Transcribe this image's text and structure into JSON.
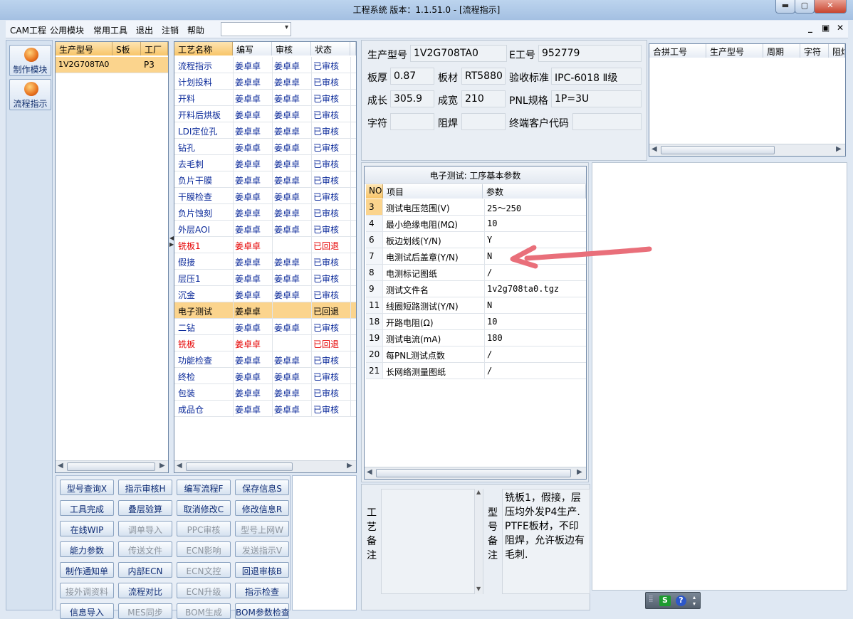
{
  "window": {
    "title": "工程系统  版本：1.1.51.0 - [流程指示]",
    "minimize": "▬",
    "maximize": "▢",
    "close": "✕"
  },
  "menu": {
    "items": [
      "CAM工程",
      "公用模块",
      "常用工具",
      "退出",
      "注销",
      "帮助"
    ],
    "combo_value": "",
    "mdi": [
      "_",
      "▣",
      "✕"
    ]
  },
  "nav": [
    {
      "label": "制作模块",
      "icon": "app-orb-icon"
    },
    {
      "label": "流程指示",
      "icon": "flow-orb-icon"
    }
  ],
  "model_list": {
    "headers": [
      "生产型号",
      "S板",
      "工厂"
    ],
    "rows": [
      [
        "1V2G708TA0",
        "",
        "P3"
      ]
    ]
  },
  "process": {
    "headers": [
      "工艺名称",
      "编写",
      "审核",
      "状态"
    ],
    "rows": [
      [
        "流程指示",
        "姜卓卓",
        "姜卓卓",
        "已审核"
      ],
      [
        "计划投料",
        "姜卓卓",
        "姜卓卓",
        "已审核"
      ],
      [
        "开料",
        "姜卓卓",
        "姜卓卓",
        "已审核"
      ],
      [
        "开料后烘板",
        "姜卓卓",
        "姜卓卓",
        "已审核"
      ],
      [
        "LDI定位孔",
        "姜卓卓",
        "姜卓卓",
        "已审核"
      ],
      [
        "钻孔",
        "姜卓卓",
        "姜卓卓",
        "已审核"
      ],
      [
        "去毛刺",
        "姜卓卓",
        "姜卓卓",
        "已审核"
      ],
      [
        "负片干膜",
        "姜卓卓",
        "姜卓卓",
        "已审核"
      ],
      [
        "干膜检查",
        "姜卓卓",
        "姜卓卓",
        "已审核"
      ],
      [
        "负片蚀刻",
        "姜卓卓",
        "姜卓卓",
        "已审核"
      ],
      [
        "外层AOI",
        "姜卓卓",
        "姜卓卓",
        "已审核"
      ],
      [
        "铣板1",
        "姜卓卓",
        "",
        "已回退"
      ],
      [
        "假接",
        "姜卓卓",
        "姜卓卓",
        "已审核"
      ],
      [
        "层压1",
        "姜卓卓",
        "姜卓卓",
        "已审核"
      ],
      [
        "沉金",
        "姜卓卓",
        "姜卓卓",
        "已审核"
      ],
      [
        "电子测试",
        "姜卓卓",
        "",
        "已回退"
      ],
      [
        "二钻",
        "姜卓卓",
        "姜卓卓",
        "已审核"
      ],
      [
        "铣板",
        "姜卓卓",
        "",
        "已回退"
      ],
      [
        "功能检查",
        "姜卓卓",
        "姜卓卓",
        "已审核"
      ],
      [
        "终检",
        "姜卓卓",
        "姜卓卓",
        "已审核"
      ],
      [
        "包装",
        "姜卓卓",
        "姜卓卓",
        "已审核"
      ],
      [
        "成品仓",
        "姜卓卓",
        "姜卓卓",
        "已审核"
      ]
    ],
    "status_colors": {
      "已审核": "#0b2a9a",
      "已回退": "#e60000"
    }
  },
  "buttons": [
    [
      "型号查询X",
      "指示审核H",
      "编写流程F",
      "保存信息S"
    ],
    [
      "工具完成",
      "叠层验算",
      "取消修改C",
      "修改信息R"
    ],
    [
      "在线WIP",
      "调单导入",
      "PPC审核",
      "型号上网W"
    ],
    [
      "能力参数",
      "传送文件",
      "ECN影响",
      "发送指示V"
    ],
    [
      "制作通知单",
      "内部ECN",
      "ECN文控",
      "回退审核B"
    ],
    [
      "接外调资料",
      "流程对比",
      "ECN升级",
      "指示检查"
    ],
    [
      "信息导入",
      "MES同步",
      "BOM生成",
      "BOM参数检查"
    ]
  ],
  "disabled_buttons": [
    "调单导入",
    "PPC审核",
    "型号上网W",
    "传送文件",
    "ECN影响",
    "发送指示V",
    "ECN文控",
    "接外调资料",
    "ECN升级",
    "MES同步",
    "BOM生成"
  ],
  "info": {
    "model_label": "生产型号",
    "model": "1V2G708TA0",
    "e_label": "E工号",
    "e": "952779",
    "thick_label": "板厚",
    "thick": "0.87",
    "mat_label": "板材",
    "mat": "RT5880",
    "std_label": "验收标准",
    "std": "IPC-6018 Ⅱ级",
    "len_label": "成长",
    "len": "305.9",
    "wid_label": "成宽",
    "wid": "210",
    "pnl_label": "PNL规格",
    "pnl": "1P=3U",
    "char_label": "字符",
    "char": "",
    "mask_label": "阻焊",
    "mask": "",
    "cust_label": "终端客户代码",
    "cust": ""
  },
  "merge": {
    "headers": [
      "合拼工号",
      "生产型号",
      "周期",
      "字符",
      "阻焊"
    ]
  },
  "params": {
    "title": "电子测试: 工序基本参数",
    "headers": [
      "NO",
      "项目",
      "参数"
    ],
    "rows": [
      [
        "3",
        "测试电压范围(V)",
        "25～250"
      ],
      [
        "4",
        "最小绝缘电阻(MΩ)",
        "10"
      ],
      [
        "6",
        "板边划线(Y/N)",
        "Y"
      ],
      [
        "7",
        "电测试后盖章(Y/N)",
        "N"
      ],
      [
        "8",
        "电测标记图纸",
        "/"
      ],
      [
        "9",
        "测试文件名",
        "1v2g708ta0.tgz"
      ],
      [
        "11",
        "线圈短路测试(Y/N)",
        "N"
      ],
      [
        "18",
        "开路电阻(Ω)",
        "10"
      ],
      [
        "19",
        "测试电流(mA)",
        "180"
      ],
      [
        "20",
        "每PNL测试点数",
        "/"
      ],
      [
        "21",
        "长网络测量图纸",
        "/"
      ]
    ]
  },
  "remarks": {
    "process_label": "工艺备注",
    "process_text": "",
    "model_label": "型号备注",
    "model_text": "铣板1，假接，层压均外发P4生产. PTFE板材，不印阻焊，允许板边有毛刺."
  },
  "tray": {
    "items": [
      "S",
      "?"
    ]
  },
  "colors": {
    "accent": "#f8c569",
    "selected_row": "#fbd48d",
    "annotation_arrow": "#e96f7a"
  }
}
